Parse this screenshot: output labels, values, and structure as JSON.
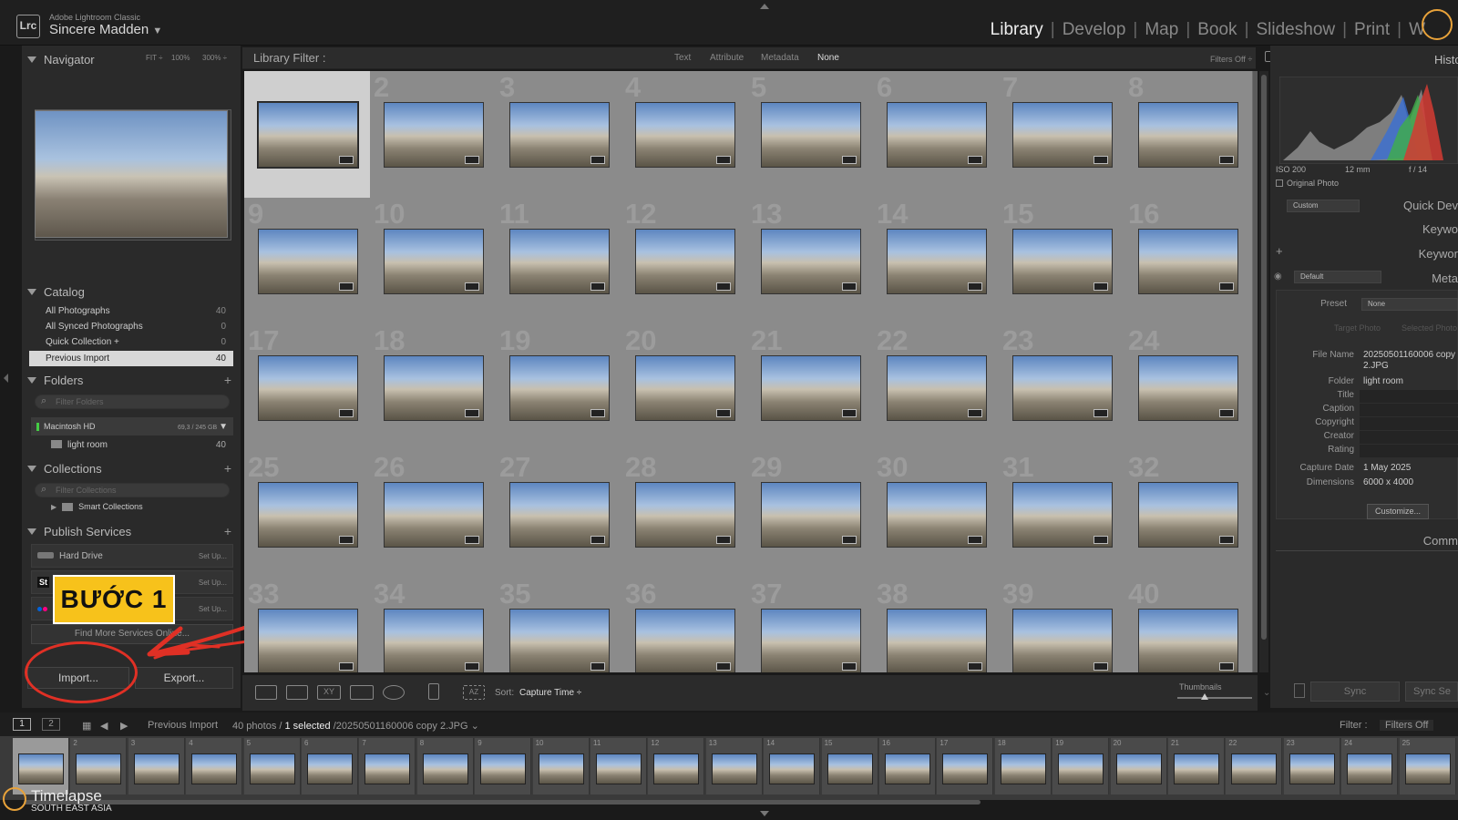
{
  "app": {
    "badge": "Lrc",
    "product": "Adobe Lightroom Classic",
    "user": "Sincere Madden",
    "user_caret": "▼"
  },
  "modules": [
    {
      "label": "Library",
      "active": true
    },
    {
      "label": "Develop"
    },
    {
      "label": "Map"
    },
    {
      "label": "Book"
    },
    {
      "label": "Slideshow"
    },
    {
      "label": "Print"
    },
    {
      "label": "W"
    }
  ],
  "module_sep": "|",
  "navigator": {
    "title": "Navigator",
    "opts": [
      "FIT ÷",
      "100%",
      "300% ÷"
    ]
  },
  "catalog": {
    "title": "Catalog",
    "items": [
      {
        "label": "All Photographs",
        "count": "40"
      },
      {
        "label": "All Synced Photographs",
        "count": "0"
      },
      {
        "label": "Quick Collection +",
        "count": "0"
      },
      {
        "label": "Previous Import",
        "count": "40",
        "selected": true
      }
    ]
  },
  "folders": {
    "title": "Folders",
    "plus": "+",
    "filter_placeholder": "Filter Folders",
    "volume": "Macintosh HD",
    "volume_size": "69,3 / 245 GB",
    "folder": "light room",
    "folder_count": "40"
  },
  "collections": {
    "title": "Collections",
    "plus": "+",
    "filter_placeholder": "Filter Collections",
    "smart": "Smart Collections"
  },
  "publish": {
    "title": "Publish Services",
    "plus": "+",
    "items": [
      {
        "label": "Hard Drive",
        "action": "Set Up..."
      },
      {
        "label": "St",
        "action": "Set Up..."
      },
      {
        "label": "",
        "action": "Set Up..."
      }
    ],
    "find_more": "Find More Services Online..."
  },
  "buttons": {
    "import": "Import...",
    "export": "Export..."
  },
  "annotation": {
    "step_label": "BƯỚC 1",
    "accent": "#e03025",
    "label_bg": "#f7c21b"
  },
  "library_filter": {
    "title": "Library Filter :",
    "options": [
      "Text",
      "Attribute",
      "Metadata",
      "None"
    ],
    "filters_off": "Filters Off ÷"
  },
  "grid": {
    "rows": 5,
    "cols": 8,
    "selected_index": 1,
    "numbers": [
      "",
      "2",
      "3",
      "4",
      "5",
      "6",
      "7",
      "8",
      "9",
      "10",
      "11",
      "12",
      "13",
      "14",
      "15",
      "16",
      "17",
      "18",
      "19",
      "20",
      "21",
      "22",
      "23",
      "24",
      "25",
      "26",
      "27",
      "28",
      "29",
      "30",
      "31",
      "32",
      "33",
      "34",
      "35",
      "36",
      "37",
      "38",
      "39",
      "40"
    ]
  },
  "toolbar": {
    "sort_label": "Sort:",
    "sort_value": "Capture Time ÷",
    "thumbnails_label": "Thumbnails"
  },
  "right": {
    "histogram_title": "Histo",
    "iso": "ISO 200",
    "focal": "12 mm",
    "aperture": "f / 14",
    "original_photo": "Original Photo",
    "custom": "Custom",
    "quick_develop": "Quick Dev",
    "keywording": "Keywo",
    "keyword_list": "Keywor",
    "metadata_preset_sel": "Default",
    "metadata": "Meta",
    "preset_label": "Preset",
    "preset_value": "None",
    "target_photo": "Target Photo",
    "selected_photo": "Selected Photo",
    "fields": [
      {
        "label": "File Name",
        "value": "20250501160006 copy 2.JPG"
      },
      {
        "label": "Folder",
        "value": "light room"
      },
      {
        "label": "Title",
        "value": ""
      },
      {
        "label": "Caption",
        "value": ""
      },
      {
        "label": "Copyright",
        "value": ""
      },
      {
        "label": "Creator",
        "value": ""
      },
      {
        "label": "Rating",
        "value": ""
      },
      {
        "label": "Capture Date",
        "value": "1 May 2025"
      },
      {
        "label": "Dimensions",
        "value": "6000 x 4000"
      }
    ],
    "customize": "Customize...",
    "comments": "Comm",
    "sync": "Sync",
    "sync_settings": "Sync Se"
  },
  "filmstrip": {
    "pages": [
      "1",
      "2"
    ],
    "source": "Previous Import",
    "status_count": "40 photos /",
    "status_selected": "1 selected",
    "status_file": "/20250501160006 copy 2.JPG ⌄",
    "filter_label": "Filter :",
    "filter_value": "Filters Off",
    "numbers": [
      "1",
      "2",
      "3",
      "4",
      "5",
      "6",
      "7",
      "8",
      "9",
      "10",
      "11",
      "12",
      "13",
      "14",
      "15",
      "16",
      "17",
      "18",
      "19",
      "20",
      "21",
      "22",
      "23",
      "24",
      "25"
    ]
  },
  "watermark": {
    "brand": "Timelapse",
    "region": "SOUTH EAST ASIA"
  }
}
